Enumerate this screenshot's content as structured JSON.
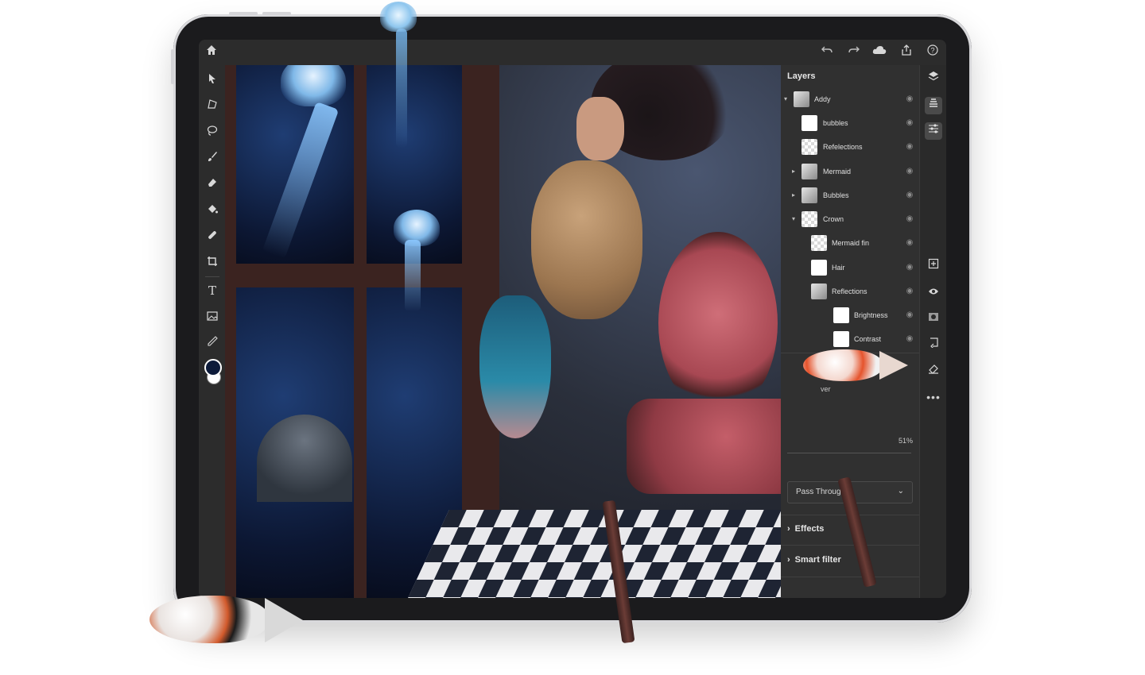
{
  "app": {
    "panel_title": "Layers"
  },
  "layers": [
    {
      "name": "Addy",
      "expanded": true,
      "level": 0
    },
    {
      "name": "bubbles",
      "level": 1
    },
    {
      "name": "Refelections",
      "level": 1
    },
    {
      "name": "Mermaid",
      "collapsed": true,
      "level": 1
    },
    {
      "name": "Bubbles",
      "collapsed": true,
      "level": 1
    },
    {
      "name": "Crown",
      "expanded": true,
      "level": 1
    },
    {
      "name": "Mermaid fin",
      "level": 2
    },
    {
      "name": "Hair",
      "level": 2
    },
    {
      "name": "Reflections",
      "level": 2
    },
    {
      "name": "Brightness",
      "level": 3
    },
    {
      "name": "Contrast",
      "level": 3
    }
  ],
  "properties": {
    "partial_label": "ver",
    "opacity_value": "51%",
    "blend_mode": "Pass Through",
    "effects_label": "Effects",
    "smart_filters_label": "Smart filter"
  },
  "icons": {
    "home": "home-icon",
    "undo": "undo-icon",
    "redo": "redo-icon",
    "cloud": "cloud-icon",
    "share": "share-icon",
    "help": "help-icon"
  },
  "colors": {
    "ui_background": "#2c2c2c",
    "panel_background": "#303030",
    "foreground_color": "#0d1b3a",
    "background_color": "#ffffff"
  }
}
